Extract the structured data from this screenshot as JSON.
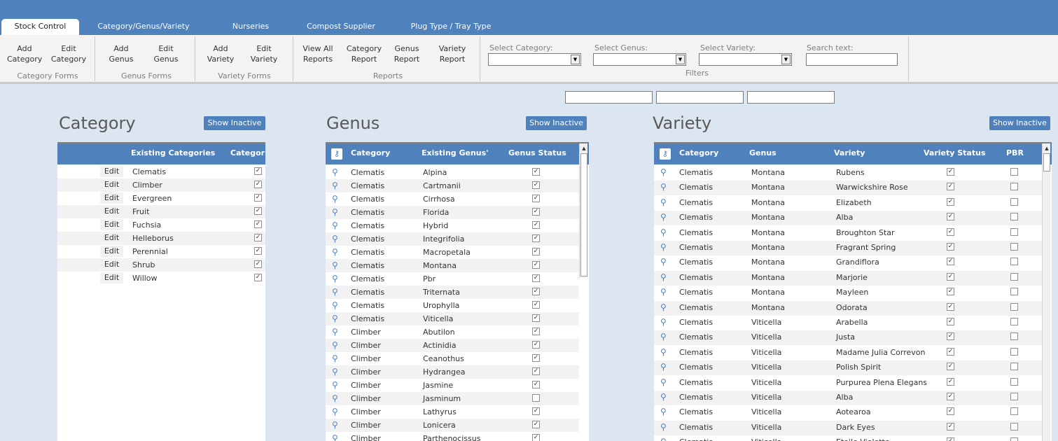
{
  "tabs": [
    "Stock Control",
    "Category/Genus/Variety",
    "Nurseries",
    "Compost Supplier",
    "Plug Type / Tray Type"
  ],
  "ribbon": {
    "category_forms": {
      "add": [
        "Add",
        "Category"
      ],
      "edit": [
        "Edit",
        "Category"
      ],
      "label": "Category Forms"
    },
    "genus_forms": {
      "add": [
        "Add",
        "Genus"
      ],
      "edit": [
        "Edit",
        "Genus"
      ],
      "label": "Genus Forms"
    },
    "variety_forms": {
      "add": [
        "Add",
        "Variety"
      ],
      "edit": [
        "Edit",
        "Variety"
      ],
      "label": "Variety Forms"
    },
    "reports": {
      "buttons": [
        [
          "View All",
          "Reports"
        ],
        [
          "Category",
          "Report"
        ],
        [
          "Genus",
          "Report"
        ],
        [
          "Variety",
          "Report"
        ]
      ],
      "label": "Reports"
    },
    "filters": {
      "select_category": "Select Category:",
      "select_genus": "Select Genus:",
      "select_variety": "Select Variety:",
      "search_text": "Search text:",
      "label": "Filters"
    }
  },
  "category": {
    "title": "Category",
    "show_inactive": "Show Inactive",
    "headers": {
      "existing": "Existing Categories",
      "status": "Categor"
    },
    "edit_label": "Edit",
    "rows": [
      {
        "name": "Clematis",
        "active": true
      },
      {
        "name": "Climber",
        "active": true
      },
      {
        "name": "Evergreen",
        "active": true
      },
      {
        "name": "Fruit",
        "active": true
      },
      {
        "name": "Fuchsia",
        "active": true
      },
      {
        "name": "Helleborus",
        "active": true
      },
      {
        "name": "Perennial",
        "active": true
      },
      {
        "name": "Shrub",
        "active": true
      },
      {
        "name": "Willow",
        "active": true
      }
    ]
  },
  "genus": {
    "title": "Genus",
    "show_inactive": "Show Inactive",
    "headers": {
      "category": "Category",
      "genus": "Existing Genus'",
      "status": "Genus Status"
    },
    "rows": [
      {
        "category": "Clematis",
        "genus": "Alpina",
        "active": true
      },
      {
        "category": "Clematis",
        "genus": "Cartmanii",
        "active": true
      },
      {
        "category": "Clematis",
        "genus": "Cirrhosa",
        "active": true
      },
      {
        "category": "Clematis",
        "genus": "Florida",
        "active": true
      },
      {
        "category": "Clematis",
        "genus": "Hybrid",
        "active": true
      },
      {
        "category": "Clematis",
        "genus": "Integrifolia",
        "active": true
      },
      {
        "category": "Clematis",
        "genus": "Macropetala",
        "active": true
      },
      {
        "category": "Clematis",
        "genus": "Montana",
        "active": true
      },
      {
        "category": "Clematis",
        "genus": "Pbr",
        "active": true
      },
      {
        "category": "Clematis",
        "genus": "Triternata",
        "active": true
      },
      {
        "category": "Clematis",
        "genus": "Urophylla",
        "active": true
      },
      {
        "category": "Clematis",
        "genus": "Viticella",
        "active": true
      },
      {
        "category": "Climber",
        "genus": "Abutilon",
        "active": true
      },
      {
        "category": "Climber",
        "genus": "Actinidia",
        "active": true
      },
      {
        "category": "Climber",
        "genus": "Ceanothus",
        "active": true
      },
      {
        "category": "Climber",
        "genus": "Hydrangea",
        "active": true
      },
      {
        "category": "Climber",
        "genus": "Jasmine",
        "active": true
      },
      {
        "category": "Climber",
        "genus": "Jasminum",
        "active": false
      },
      {
        "category": "Climber",
        "genus": "Lathyrus",
        "active": true
      },
      {
        "category": "Climber",
        "genus": "Lonicera",
        "active": true
      },
      {
        "category": "Climber",
        "genus": "Parthenocissus",
        "active": true
      }
    ]
  },
  "variety": {
    "title": "Variety",
    "show_inactive": "Show Inactive",
    "headers": {
      "category": "Category",
      "genus": "Genus",
      "variety": "Variety",
      "status": "Variety Status",
      "pbr": "PBR"
    },
    "rows": [
      {
        "category": "Clematis",
        "genus": "Montana",
        "variety": "Rubens",
        "active": true,
        "pbr": false
      },
      {
        "category": "Clematis",
        "genus": "Montana",
        "variety": "Warwickshire Rose",
        "active": true,
        "pbr": false
      },
      {
        "category": "Clematis",
        "genus": "Montana",
        "variety": "Elizabeth",
        "active": true,
        "pbr": false
      },
      {
        "category": "Clematis",
        "genus": "Montana",
        "variety": "Alba",
        "active": true,
        "pbr": false
      },
      {
        "category": "Clematis",
        "genus": "Montana",
        "variety": "Broughton Star",
        "active": true,
        "pbr": false
      },
      {
        "category": "Clematis",
        "genus": "Montana",
        "variety": "Fragrant Spring",
        "active": true,
        "pbr": false
      },
      {
        "category": "Clematis",
        "genus": "Montana",
        "variety": "Grandiflora",
        "active": true,
        "pbr": false
      },
      {
        "category": "Clematis",
        "genus": "Montana",
        "variety": "Marjorie",
        "active": true,
        "pbr": false
      },
      {
        "category": "Clematis",
        "genus": "Montana",
        "variety": "Mayleen",
        "active": true,
        "pbr": false
      },
      {
        "category": "Clematis",
        "genus": "Montana",
        "variety": "Odorata",
        "active": true,
        "pbr": false
      },
      {
        "category": "Clematis",
        "genus": "Viticella",
        "variety": "Arabella",
        "active": true,
        "pbr": false
      },
      {
        "category": "Clematis",
        "genus": "Viticella",
        "variety": "Justa",
        "active": true,
        "pbr": false
      },
      {
        "category": "Clematis",
        "genus": "Viticella",
        "variety": "Madame Julia Correvon",
        "active": true,
        "pbr": false
      },
      {
        "category": "Clematis",
        "genus": "Viticella",
        "variety": "Polish Spirit",
        "active": true,
        "pbr": false
      },
      {
        "category": "Clematis",
        "genus": "Viticella",
        "variety": "Purpurea Plena Elegans",
        "active": true,
        "pbr": false
      },
      {
        "category": "Clematis",
        "genus": "Viticella",
        "variety": "Alba",
        "active": true,
        "pbr": false
      },
      {
        "category": "Clematis",
        "genus": "Viticella",
        "variety": "Aotearoa",
        "active": true,
        "pbr": false
      },
      {
        "category": "Clematis",
        "genus": "Viticella",
        "variety": "Dark Eyes",
        "active": true,
        "pbr": false
      },
      {
        "category": "Clematis",
        "genus": "Viticella",
        "variety": "Etoile Violette",
        "active": true,
        "pbr": false
      }
    ]
  }
}
